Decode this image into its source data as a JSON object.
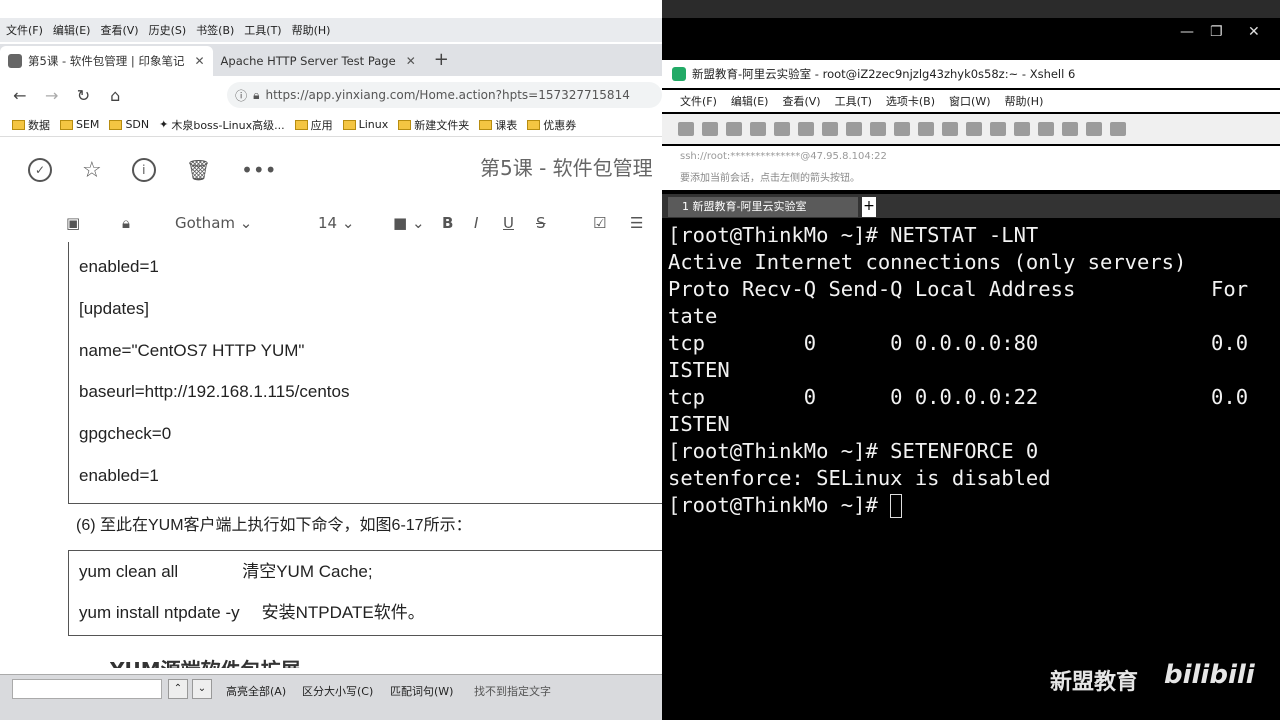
{
  "browser": {
    "menu": [
      "文件(F)",
      "编辑(E)",
      "查看(V)",
      "历史(S)",
      "书签(B)",
      "工具(T)",
      "帮助(H)"
    ],
    "tabs": [
      {
        "title": "第5课 - 软件包管理 | 印象笔记"
      },
      {
        "title": "Apache HTTP Server Test Page"
      }
    ],
    "url": "https://app.yinxiang.com/Home.action?hpts=157327715814",
    "bookmarks": [
      "数据",
      "SEM",
      "SDN",
      "木泉boss-Linux高级...",
      "应用",
      "Linux",
      "新建文件夹",
      "课表",
      "优惠券"
    ]
  },
  "note": {
    "title": "第5课 - 软件包管理",
    "font": "Gotham",
    "font_size": "14",
    "repo_lines": [
      "enabled=1",
      "[updates]",
      "name=\"CentOS7 HTTP YUM\"",
      "baseurl=http://192.168.1.115/centos",
      "gpgcheck=0",
      "enabled=1"
    ],
    "caption": "(6)        至此在YUM客户端上执行如下命令，如图6-17所示：",
    "commands": [
      {
        "cmd": "yum clean all",
        "desc": "清空YUM Cache;"
      },
      {
        "cmd": "yum install ntpdate -y",
        "desc": "安装NTPDATE软件。"
      }
    ],
    "section_title": "YUM源端软件包扩展"
  },
  "findbar": {
    "options": [
      "高亮全部(A)",
      "区分大小写(C)",
      "匹配词句(W)",
      "找不到指定文字"
    ]
  },
  "xshell": {
    "title": "新盟教育-阿里云实验室 - root@iZ2zec9njzlg43zhyk0s58z:~ - Xshell 6",
    "menu": [
      "文件(F)",
      "编辑(E)",
      "查看(V)",
      "工具(T)",
      "选项卡(B)",
      "窗口(W)",
      "帮助(H)"
    ],
    "address": "ssh://root:**************@47.95.8.104:22",
    "hint": "要添加当前会话，点击左侧的箭头按钮。",
    "tab": "1 新盟教育-阿里云实验室",
    "terminal_lines": [
      "[root@ThinkMo ~]# NETSTAT -LNT",
      "Active Internet connections (only servers)",
      "Proto Recv-Q Send-Q Local Address           For",
      "tate",
      "tcp        0      0 0.0.0.0:80              0.0",
      "ISTEN",
      "tcp        0      0 0.0.0.0:22              0.0",
      "ISTEN",
      "[root@ThinkMo ~]# SETENFORCE 0",
      "setenforce: SELinux is disabled",
      "[root@ThinkMo ~]# "
    ]
  },
  "watermark": {
    "text": "新盟教育",
    "logo": "bilibili"
  },
  "colors": {
    "terminal_bg": "#000000",
    "terminal_fg": "#f2f2f2"
  }
}
